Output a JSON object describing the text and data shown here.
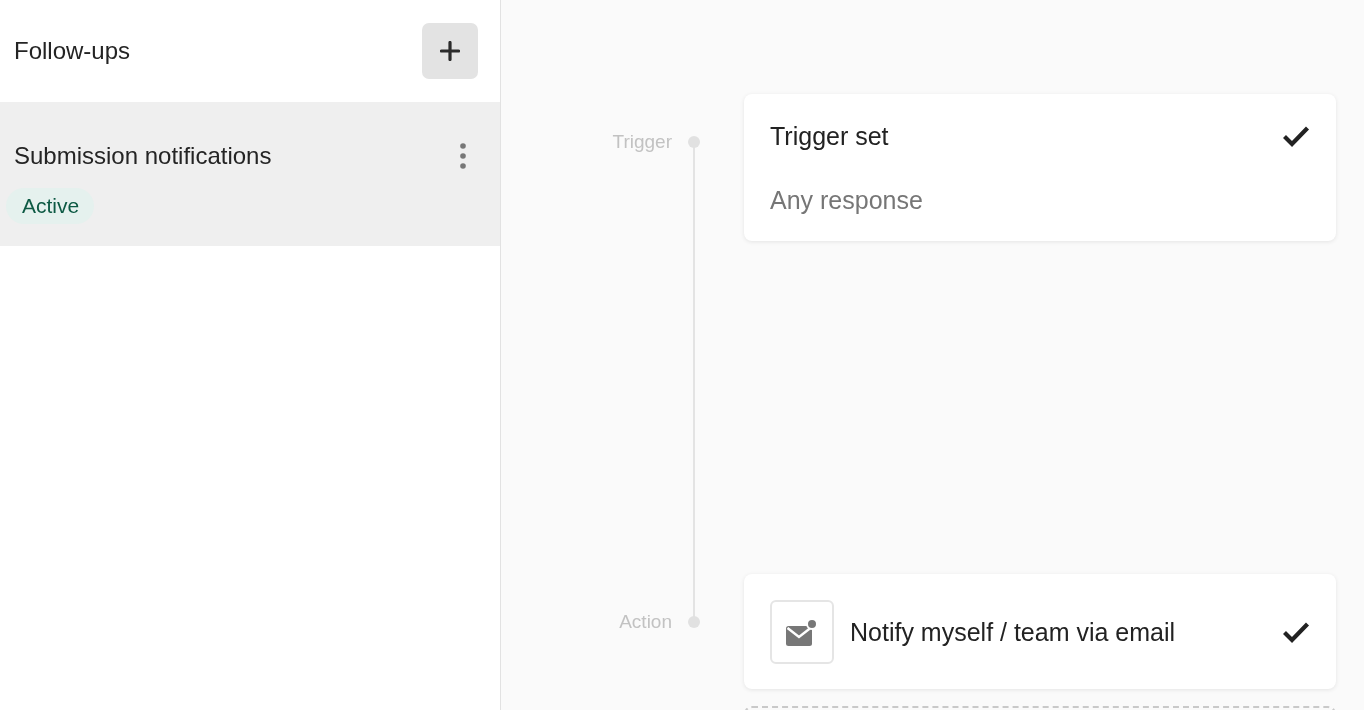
{
  "sidebar": {
    "title": "Follow-ups",
    "items": [
      {
        "name": "Submission notifications",
        "status": "Active",
        "selected": true
      }
    ]
  },
  "flow": {
    "steps": [
      {
        "kind": "trigger",
        "label": "Trigger",
        "title": "Trigger set",
        "detail": "Any response",
        "done": true
      },
      {
        "kind": "action",
        "label": "Action",
        "title": "Notify myself / team via email",
        "done": true
      }
    ]
  }
}
